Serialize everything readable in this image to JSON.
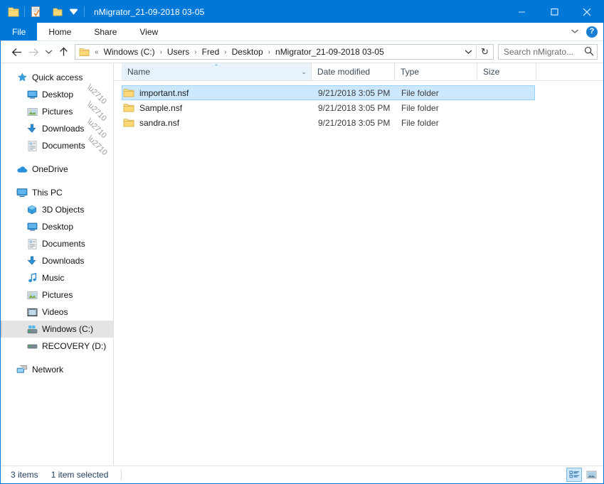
{
  "window": {
    "title": "nMigrator_21-09-2018 03-05",
    "accent_color": "#0078d7",
    "selection_color": "#cce8ff",
    "quick_access_toolbar": [
      {
        "icon": "folder-icon",
        "name": "system-menu-icon"
      },
      {
        "icon": "properties-icon",
        "name": "properties-button"
      },
      {
        "icon": "new-folder-icon",
        "name": "new-folder-button"
      },
      {
        "icon": "chevron-down-icon",
        "name": "customize-qat-button"
      }
    ],
    "controls": {
      "minimize": "–",
      "maximize": "□",
      "close": "✕"
    }
  },
  "ribbon": {
    "tabs": [
      {
        "label": "File",
        "active": true
      },
      {
        "label": "Home",
        "active": false
      },
      {
        "label": "Share",
        "active": false
      },
      {
        "label": "View",
        "active": false
      }
    ],
    "collapse_icon": "chevron-down-icon",
    "help_label": "?"
  },
  "navigation": {
    "back": {
      "label": "←",
      "enabled": true
    },
    "forward": {
      "label": "→",
      "enabled": false
    },
    "recent": {
      "label": "⌄",
      "enabled": true
    },
    "up": {
      "label": "↑",
      "enabled": true
    },
    "breadcrumb_overflow": "«",
    "breadcrumb": [
      "Windows (C:)",
      "Users",
      "Fred",
      "Desktop",
      "nMigrator_21-09-2018 03-05"
    ],
    "separator": "›",
    "dropdown_icon": "chevron-down-icon",
    "refresh_icon": "↻"
  },
  "search": {
    "placeholder": "Search nMigrato...",
    "value": "",
    "icon": "search-icon"
  },
  "sidebar": {
    "items": [
      {
        "label": "Quick access",
        "icon": "star-icon",
        "level": 0,
        "pinned": false,
        "selected": false
      },
      {
        "label": "Desktop",
        "icon": "desktop-icon",
        "level": 1,
        "pinned": true,
        "selected": false
      },
      {
        "label": "Pictures",
        "icon": "pictures-icon",
        "level": 1,
        "pinned": true,
        "selected": false
      },
      {
        "label": "Downloads",
        "icon": "downloads-icon",
        "level": 1,
        "pinned": true,
        "selected": false
      },
      {
        "label": "Documents",
        "icon": "documents-icon",
        "level": 1,
        "pinned": true,
        "selected": false
      },
      {
        "label": "OneDrive",
        "icon": "cloud-icon",
        "level": 0,
        "pinned": false,
        "selected": false,
        "gap_before": true
      },
      {
        "label": "This PC",
        "icon": "thispc-icon",
        "level": 0,
        "pinned": false,
        "selected": false,
        "gap_before": true
      },
      {
        "label": "3D Objects",
        "icon": "3dobjects-icon",
        "level": 1,
        "pinned": false,
        "selected": false
      },
      {
        "label": "Desktop",
        "icon": "desktop-icon",
        "level": 1,
        "pinned": false,
        "selected": false
      },
      {
        "label": "Documents",
        "icon": "documents-icon",
        "level": 1,
        "pinned": false,
        "selected": false
      },
      {
        "label": "Downloads",
        "icon": "downloads-icon",
        "level": 1,
        "pinned": false,
        "selected": false
      },
      {
        "label": "Music",
        "icon": "music-icon",
        "level": 1,
        "pinned": false,
        "selected": false
      },
      {
        "label": "Pictures",
        "icon": "pictures-icon",
        "level": 1,
        "pinned": false,
        "selected": false
      },
      {
        "label": "Videos",
        "icon": "videos-icon",
        "level": 1,
        "pinned": false,
        "selected": false
      },
      {
        "label": "Windows (C:)",
        "icon": "harddrive-icon",
        "level": 1,
        "pinned": false,
        "selected": true
      },
      {
        "label": "RECOVERY (D:)",
        "icon": "drive-icon",
        "level": 1,
        "pinned": false,
        "selected": false
      },
      {
        "label": "Network",
        "icon": "network-icon",
        "level": 0,
        "pinned": false,
        "selected": false,
        "gap_before": true
      }
    ]
  },
  "filelist": {
    "columns": [
      {
        "label": "Name",
        "key": "name",
        "sorted": true,
        "sort_direction": "asc"
      },
      {
        "label": "Date modified",
        "key": "date",
        "sorted": false,
        "sort_direction": ""
      },
      {
        "label": "Type",
        "key": "type",
        "sorted": false,
        "sort_direction": ""
      },
      {
        "label": "Size",
        "key": "size",
        "sorted": false,
        "sort_direction": ""
      }
    ],
    "sort_ascending_glyph": "⌃",
    "column_dropdown_glyph": "⌄",
    "rows": [
      {
        "name": "important.nsf",
        "date": "9/21/2018 3:05 PM",
        "type": "File folder",
        "size": "",
        "icon": "folder-icon",
        "selected": true
      },
      {
        "name": "Sample.nsf",
        "date": "9/21/2018 3:05 PM",
        "type": "File folder",
        "size": "",
        "icon": "folder-icon",
        "selected": false
      },
      {
        "name": "sandra.nsf",
        "date": "9/21/2018 3:05 PM",
        "type": "File folder",
        "size": "",
        "icon": "folder-icon",
        "selected": false
      }
    ]
  },
  "statusbar": {
    "item_count": "3 items",
    "selection_text": "1 item selected",
    "views": [
      {
        "name": "details-view-button",
        "icon": "details-view-icon",
        "active": true
      },
      {
        "name": "large-icons-view-button",
        "icon": "large-icons-view-icon",
        "active": false
      }
    ]
  }
}
